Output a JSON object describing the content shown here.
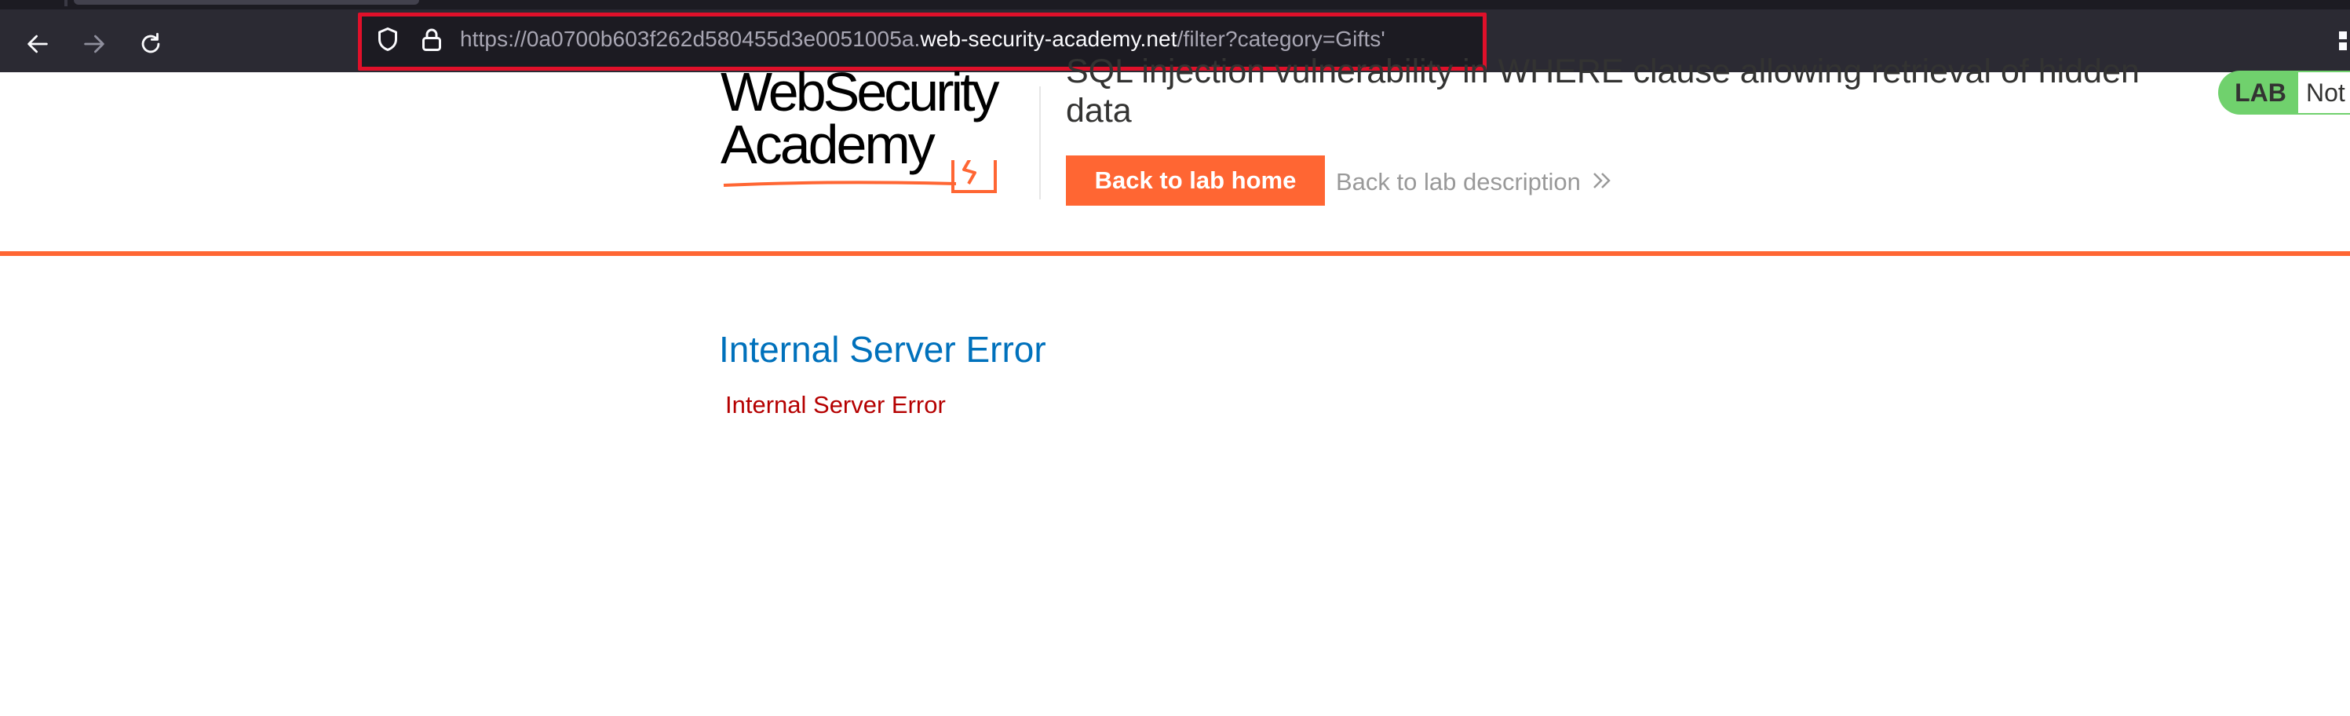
{
  "browser": {
    "url": {
      "prefix": "https://0a0700b603f262d580455d3e0051005a.",
      "domain": "web-security-academy.net",
      "path": "/filter?category=Gifts'"
    },
    "icons": [
      "back-arrow-icon",
      "forward-arrow-icon",
      "reload-icon",
      "shield-icon",
      "lock-icon"
    ]
  },
  "header": {
    "logo_line1": "WebSecurity",
    "logo_line2": "Academy",
    "lab_title": "SQL injection vulnerability in WHERE clause allowing retrieval of hidden data",
    "back_home_label": "Back to lab home",
    "back_description_label": "Back to lab description",
    "badge_label": "LAB",
    "badge_status": "Not"
  },
  "content": {
    "error_heading": "Internal Server Error",
    "error_message": "Internal Server Error"
  },
  "colors": {
    "accent": "#ff6633",
    "heading_blue": "#0071bc",
    "error_red": "#b50000",
    "badge_green": "#70d16d",
    "url_highlight": "#e0102a"
  }
}
